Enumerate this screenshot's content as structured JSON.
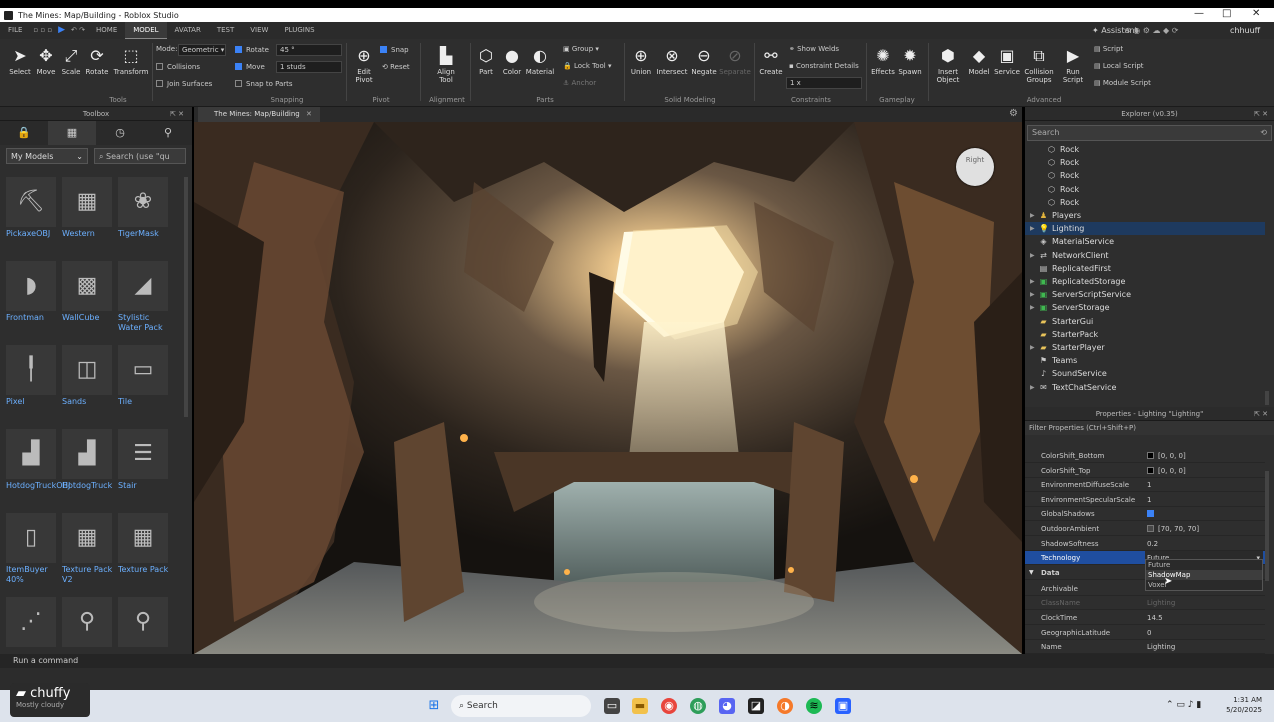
{
  "window": {
    "title": "The Mines: Map/Building - Roblox Studio",
    "controls": [
      "—",
      "□",
      "✕"
    ]
  },
  "menu": {
    "file": "FILE",
    "tabs": [
      "HOME",
      "MODEL",
      "AVATAR",
      "TEST",
      "VIEW",
      "PLUGINS"
    ],
    "active_tab": "MODEL",
    "assistant": "Assistant",
    "user": "chhuuff"
  },
  "ribbon": {
    "tools": {
      "select": "Select",
      "move": "Move",
      "scale": "Scale",
      "rotate": "Rotate",
      "transform": "Transform",
      "group_label": "Tools"
    },
    "snapping": {
      "mode_label": "Mode:",
      "mode_value": "Geometric",
      "collisions": "Collisions",
      "join_surfaces": "Join Surfaces",
      "rotate_label": "Rotate",
      "rotate_value": "45 °",
      "move_label": "Move",
      "move_value": "1 studs",
      "snap_to_parts": "Snap to Parts",
      "group_label": "Snapping"
    },
    "pivot": {
      "snap": "Snap",
      "reset": "Reset",
      "edit_pivot": "Edit\nPivot",
      "group_label": "Pivot"
    },
    "alignment": {
      "align_tool": "Align\nTool",
      "group_label": "Alignment"
    },
    "parts": {
      "part": "Part",
      "color": "Color",
      "material": "Material",
      "group": "Group",
      "lock_tool": "Lock Tool",
      "anchor": "Anchor",
      "group_label": "Parts"
    },
    "solid_modeling": {
      "union": "Union",
      "intersect": "Intersect",
      "negate": "Negate",
      "separate": "Separate",
      "group_label": "Solid Modeling"
    },
    "constraints": {
      "create": "Create",
      "show_welds": "Show Welds",
      "constraint_details": "Constraint Details",
      "scale_value": "1 x",
      "group_label": "Constraints"
    },
    "gameplay": {
      "effects": "Effects",
      "spawn": "Spawn",
      "group_label": "Gameplay"
    },
    "advanced": {
      "insert_object": "Insert\nObject",
      "model": "Model",
      "service": "Service",
      "collision_groups": "Collision\nGroups",
      "run_script": "Run\nScript",
      "script": "Script",
      "local_script": "Local Script",
      "module_script": "Module Script",
      "group_label": "Advanced"
    }
  },
  "toolbox": {
    "title": "Toolbox",
    "category": "My Models",
    "search_placeholder": "Search (use \"qu",
    "items": [
      {
        "name": "PickaxeOBJ"
      },
      {
        "name": "Western"
      },
      {
        "name": "TigerMask"
      },
      {
        "name": "Frontman"
      },
      {
        "name": "WallCube"
      },
      {
        "name": "Stylistic Water Pack"
      },
      {
        "name": "Pixel"
      },
      {
        "name": "Sands"
      },
      {
        "name": "Tile"
      },
      {
        "name": "HotdogTruckOBJ"
      },
      {
        "name": "HotdogTruck"
      },
      {
        "name": "Stair"
      },
      {
        "name": "ItemBuyer 40%"
      },
      {
        "name": "Texture Pack V2"
      },
      {
        "name": "Texture Pack"
      },
      {
        "name": ""
      },
      {
        "name": ""
      },
      {
        "name": ""
      }
    ]
  },
  "viewport": {
    "tab": "The Mines: Map/Building",
    "view_cube": "Right"
  },
  "explorer": {
    "title": "Explorer (v0.35)",
    "search_placeholder": "Search",
    "items": [
      {
        "label": "Rock",
        "indent": 2,
        "icon": "part-icon",
        "arrow": false
      },
      {
        "label": "Rock",
        "indent": 2,
        "icon": "part-icon",
        "arrow": false
      },
      {
        "label": "Rock",
        "indent": 2,
        "icon": "part-icon",
        "arrow": false
      },
      {
        "label": "Rock",
        "indent": 2,
        "icon": "part-icon",
        "arrow": false
      },
      {
        "label": "Rock",
        "indent": 2,
        "icon": "part-icon",
        "arrow": false
      },
      {
        "label": "Players",
        "indent": 1,
        "icon": "players-icon",
        "arrow": true
      },
      {
        "label": "Lighting",
        "indent": 1,
        "icon": "lighting-icon",
        "arrow": true,
        "selected": true
      },
      {
        "label": "MaterialService",
        "indent": 1,
        "icon": "material-icon",
        "arrow": false
      },
      {
        "label": "NetworkClient",
        "indent": 1,
        "icon": "network-icon",
        "arrow": true
      },
      {
        "label": "ReplicatedFirst",
        "indent": 1,
        "icon": "replicated-icon",
        "arrow": false
      },
      {
        "label": "ReplicatedStorage",
        "indent": 1,
        "icon": "storage-icon",
        "arrow": true
      },
      {
        "label": "ServerScriptService",
        "indent": 1,
        "icon": "server-script-icon",
        "arrow": true
      },
      {
        "label": "ServerStorage",
        "indent": 1,
        "icon": "server-storage-icon",
        "arrow": true
      },
      {
        "label": "StarterGui",
        "indent": 1,
        "icon": "folder-icon",
        "arrow": false
      },
      {
        "label": "StarterPack",
        "indent": 1,
        "icon": "folder-icon",
        "arrow": false
      },
      {
        "label": "StarterPlayer",
        "indent": 1,
        "icon": "folder-icon",
        "arrow": true
      },
      {
        "label": "Teams",
        "indent": 1,
        "icon": "teams-icon",
        "arrow": false
      },
      {
        "label": "SoundService",
        "indent": 1,
        "icon": "sound-icon",
        "arrow": false
      },
      {
        "label": "TextChatService",
        "indent": 1,
        "icon": "chat-icon",
        "arrow": true
      }
    ]
  },
  "properties": {
    "title": "Properties - Lighting \"Lighting\"",
    "filter_placeholder": "Filter Properties (Ctrl+Shift+P)",
    "rows": [
      {
        "key": "ColorShift_Bottom",
        "value": "[0, 0, 0]",
        "swatch": "#000000"
      },
      {
        "key": "ColorShift_Top",
        "value": "[0, 0, 0]",
        "swatch": "#000000"
      },
      {
        "key": "EnvironmentDiffuseScale",
        "value": "1"
      },
      {
        "key": "EnvironmentSpecularScale",
        "value": "1"
      },
      {
        "key": "GlobalShadows",
        "value": "",
        "checkbox": true
      },
      {
        "key": "OutdoorAmbient",
        "value": "[70, 70, 70]",
        "swatch": "#464646"
      },
      {
        "key": "ShadowSoftness",
        "value": "0.2"
      },
      {
        "key": "Technology",
        "value": "Future",
        "selected": true
      }
    ],
    "data_section": "Data",
    "data_rows": [
      {
        "key": "Archivable",
        "value": "Voxel"
      },
      {
        "key": "ClassName",
        "value": "Lighting",
        "dim": true
      },
      {
        "key": "ClockTime",
        "value": "14.5"
      },
      {
        "key": "GeographicLatitude",
        "value": "0"
      },
      {
        "key": "Name",
        "value": "Lighting"
      }
    ],
    "dropdown_options": [
      "Future",
      "ShadowMap",
      "Voxel"
    ],
    "dropdown_highlighted": "ShadowMap"
  },
  "command_bar": {
    "placeholder": "Run a command"
  },
  "weather": {
    "title": "chuffy",
    "subtitle": "Mostly cloudy"
  },
  "taskbar": {
    "search": "Search",
    "time": "1:31 AM",
    "date": "5/20/2025"
  }
}
